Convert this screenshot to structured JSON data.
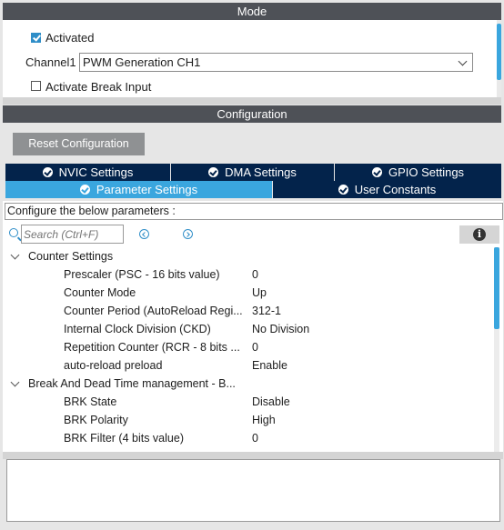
{
  "mode": {
    "header": "Mode",
    "activated_label": "Activated",
    "activated_checked": true,
    "channel_label": "Channel1",
    "channel_value": "PWM Generation CH1",
    "break_label": "Activate Break Input",
    "break_checked": false
  },
  "configuration": {
    "header": "Configuration",
    "reset_button": "Reset Configuration",
    "tabs_row1": [
      "NVIC Settings",
      "DMA Settings",
      "GPIO Settings"
    ],
    "tabs_row2": [
      "Parameter Settings",
      "User Constants"
    ],
    "active_tab": "Parameter Settings",
    "instructions": "Configure the below parameters :",
    "search_placeholder": "Search (Ctrl+F)",
    "groups": [
      {
        "name": "Counter Settings",
        "params": [
          {
            "name": "Prescaler (PSC - 16 bits value)",
            "value": "0"
          },
          {
            "name": "Counter Mode",
            "value": "Up"
          },
          {
            "name": "Counter Period (AutoReload Regi...",
            "value": "312-1"
          },
          {
            "name": "Internal Clock Division (CKD)",
            "value": "No Division"
          },
          {
            "name": "Repetition Counter (RCR - 8 bits ...",
            "value": "0"
          },
          {
            "name": "auto-reload preload",
            "value": "Enable"
          }
        ]
      },
      {
        "name": "Break And Dead Time management - B...",
        "params": [
          {
            "name": "BRK State",
            "value": "Disable"
          },
          {
            "name": "BRK Polarity",
            "value": "High"
          },
          {
            "name": "BRK Filter (4 bits value)",
            "value": "0"
          }
        ]
      }
    ]
  },
  "colors": {
    "header_bg": "#4e5157",
    "tab_dark": "#03234b",
    "tab_active": "#3aa6de",
    "accent": "#2f8ec8"
  }
}
